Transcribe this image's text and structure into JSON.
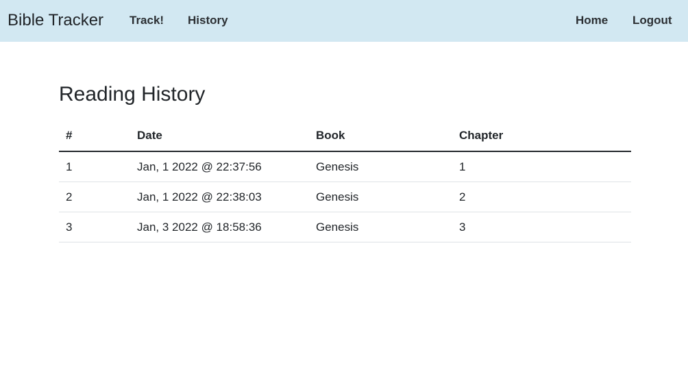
{
  "navbar": {
    "brand": "Bible Tracker",
    "links_left": [
      "Track!",
      "History"
    ],
    "links_right": [
      "Home",
      "Logout"
    ],
    "background": "#d2e8f2"
  },
  "page": {
    "title": "Reading History"
  },
  "table": {
    "headers": [
      "#",
      "Date",
      "Book",
      "Chapter"
    ],
    "rows": [
      [
        "1",
        "Jan, 1 2022 @ 22:37:56",
        "Genesis",
        "1"
      ],
      [
        "2",
        "Jan, 1 2022 @ 22:38:03",
        "Genesis",
        "2"
      ],
      [
        "3",
        "Jan, 3 2022 @ 18:58:36",
        "Genesis",
        "3"
      ]
    ]
  }
}
